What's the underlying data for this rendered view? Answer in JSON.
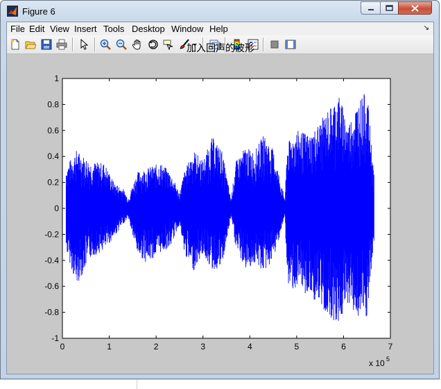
{
  "window": {
    "title": "Figure 6"
  },
  "menu": {
    "items": [
      "File",
      "Edit",
      "View",
      "Insert",
      "Tools",
      "Desktop",
      "Window",
      "Help"
    ]
  },
  "toolbar": {
    "icons": [
      "new-figure-icon",
      "open-file-icon",
      "save-icon",
      "print-icon",
      "select-arrow-icon",
      "zoom-in-icon",
      "zoom-out-icon",
      "pan-hand-icon",
      "rotate-3d-icon",
      "data-cursor-icon",
      "brush-icon",
      "link-plot-icon",
      "colorbar-icon",
      "legend-icon",
      "hide-plot-tools-icon",
      "show-plot-tools-icon"
    ]
  },
  "chart_data": {
    "type": "line",
    "title": "加入回声的波形",
    "xlabel": "",
    "ylabel": "",
    "xlim": [
      0,
      7
    ],
    "ylim": [
      -1,
      1
    ],
    "x_multiplier_label": "x 10",
    "x_multiplier_exponent": "5",
    "x_ticks": [
      "0",
      "1",
      "2",
      "3",
      "4",
      "5",
      "6",
      "7"
    ],
    "y_ticks": [
      "1",
      "0.8",
      "0.6",
      "0.4",
      "0.2",
      "0",
      "-0.2",
      "-0.4",
      "-0.6",
      "-0.8",
      "-1"
    ],
    "series_color": "#0000ff",
    "envelope": {
      "x": [
        0.08,
        0.3,
        0.6,
        0.9,
        1.1,
        1.3,
        1.4,
        1.6,
        1.8,
        2.1,
        2.3,
        2.5,
        2.6,
        2.8,
        3.0,
        3.2,
        3.4,
        3.6,
        3.7,
        3.9,
        4.1,
        4.3,
        4.5,
        4.75,
        4.8,
        5.0,
        5.3,
        5.6,
        5.9,
        6.1,
        6.3,
        6.5,
        6.65
      ],
      "max": [
        0.32,
        0.45,
        0.36,
        0.35,
        0.2,
        0.15,
        0.08,
        0.28,
        0.31,
        0.35,
        0.28,
        0.12,
        0.28,
        0.45,
        0.37,
        0.55,
        0.45,
        0.07,
        0.36,
        0.47,
        0.44,
        0.57,
        0.45,
        0.07,
        0.5,
        0.6,
        0.57,
        0.72,
        0.88,
        0.65,
        0.82,
        0.91,
        0.26
      ],
      "min": [
        -0.32,
        -0.6,
        -0.38,
        -0.32,
        -0.22,
        -0.12,
        -0.07,
        -0.35,
        -0.42,
        -0.34,
        -0.3,
        -0.12,
        -0.35,
        -0.48,
        -0.35,
        -0.48,
        -0.46,
        -0.07,
        -0.3,
        -0.47,
        -0.43,
        -0.49,
        -0.4,
        -0.06,
        -0.6,
        -0.63,
        -0.68,
        -0.8,
        -0.9,
        -0.72,
        -0.85,
        -0.86,
        -0.28
      ]
    }
  }
}
